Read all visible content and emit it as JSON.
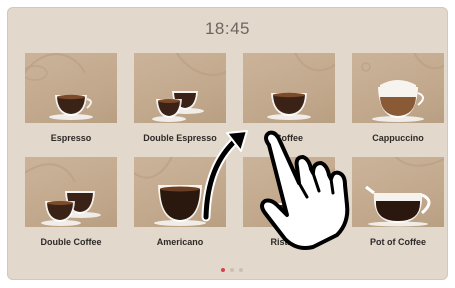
{
  "status": {
    "time": "18:45"
  },
  "products": [
    {
      "label": "Espresso",
      "icon": "espresso-cup-icon"
    },
    {
      "label": "Double Espresso",
      "icon": "double-espresso-cups-icon"
    },
    {
      "label": "Coffee",
      "icon": "coffee-cup-icon"
    },
    {
      "label": "Cappuccino",
      "icon": "cappuccino-cup-icon"
    },
    {
      "label": "Double Coffee",
      "icon": "double-coffee-cups-icon"
    },
    {
      "label": "Americano",
      "icon": "americano-cup-icon"
    },
    {
      "label": "Ristretto",
      "icon": "ristretto-cup-icon"
    },
    {
      "label": "Pot of Coffee",
      "icon": "coffee-pot-icon"
    }
  ],
  "pagination": {
    "pages": 3,
    "current": 1
  },
  "gesture": {
    "icon": "swipe-hand-icon",
    "arrow": "swipe-arrow-icon"
  },
  "colors": {
    "background": "#e2d8cc",
    "tile": "#c6ad91",
    "active_dot": "#d9414a",
    "text": "#2e2a27"
  }
}
